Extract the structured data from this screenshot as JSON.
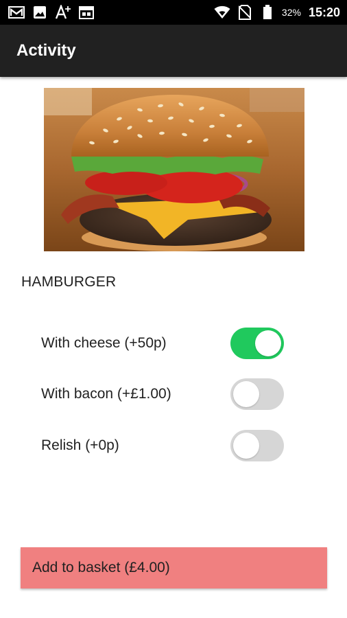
{
  "status_bar": {
    "icons_left": [
      "gmail-icon",
      "image-icon",
      "text-size-icon",
      "calendar-icon"
    ],
    "icons_right": [
      "wifi-icon",
      "no-sim-icon",
      "battery-icon"
    ],
    "battery_percent": "32%",
    "time": "15:20"
  },
  "app_bar": {
    "title": "Activity"
  },
  "product": {
    "image_icon": "hamburger-photo",
    "name": "HAMBURGER"
  },
  "options": [
    {
      "label": "With cheese (+50p)",
      "enabled": true
    },
    {
      "label": "With bacon (+£1.00)",
      "enabled": false
    },
    {
      "label": "Relish (+0p)",
      "enabled": false
    }
  ],
  "add_button": {
    "label": "Add to basket (£4.00)"
  },
  "colors": {
    "status_bar_bg": "#000000",
    "app_bar_bg": "#212121",
    "switch_on": "#20c95d",
    "switch_off": "#d6d6d6",
    "button_bg": "#f08080"
  }
}
